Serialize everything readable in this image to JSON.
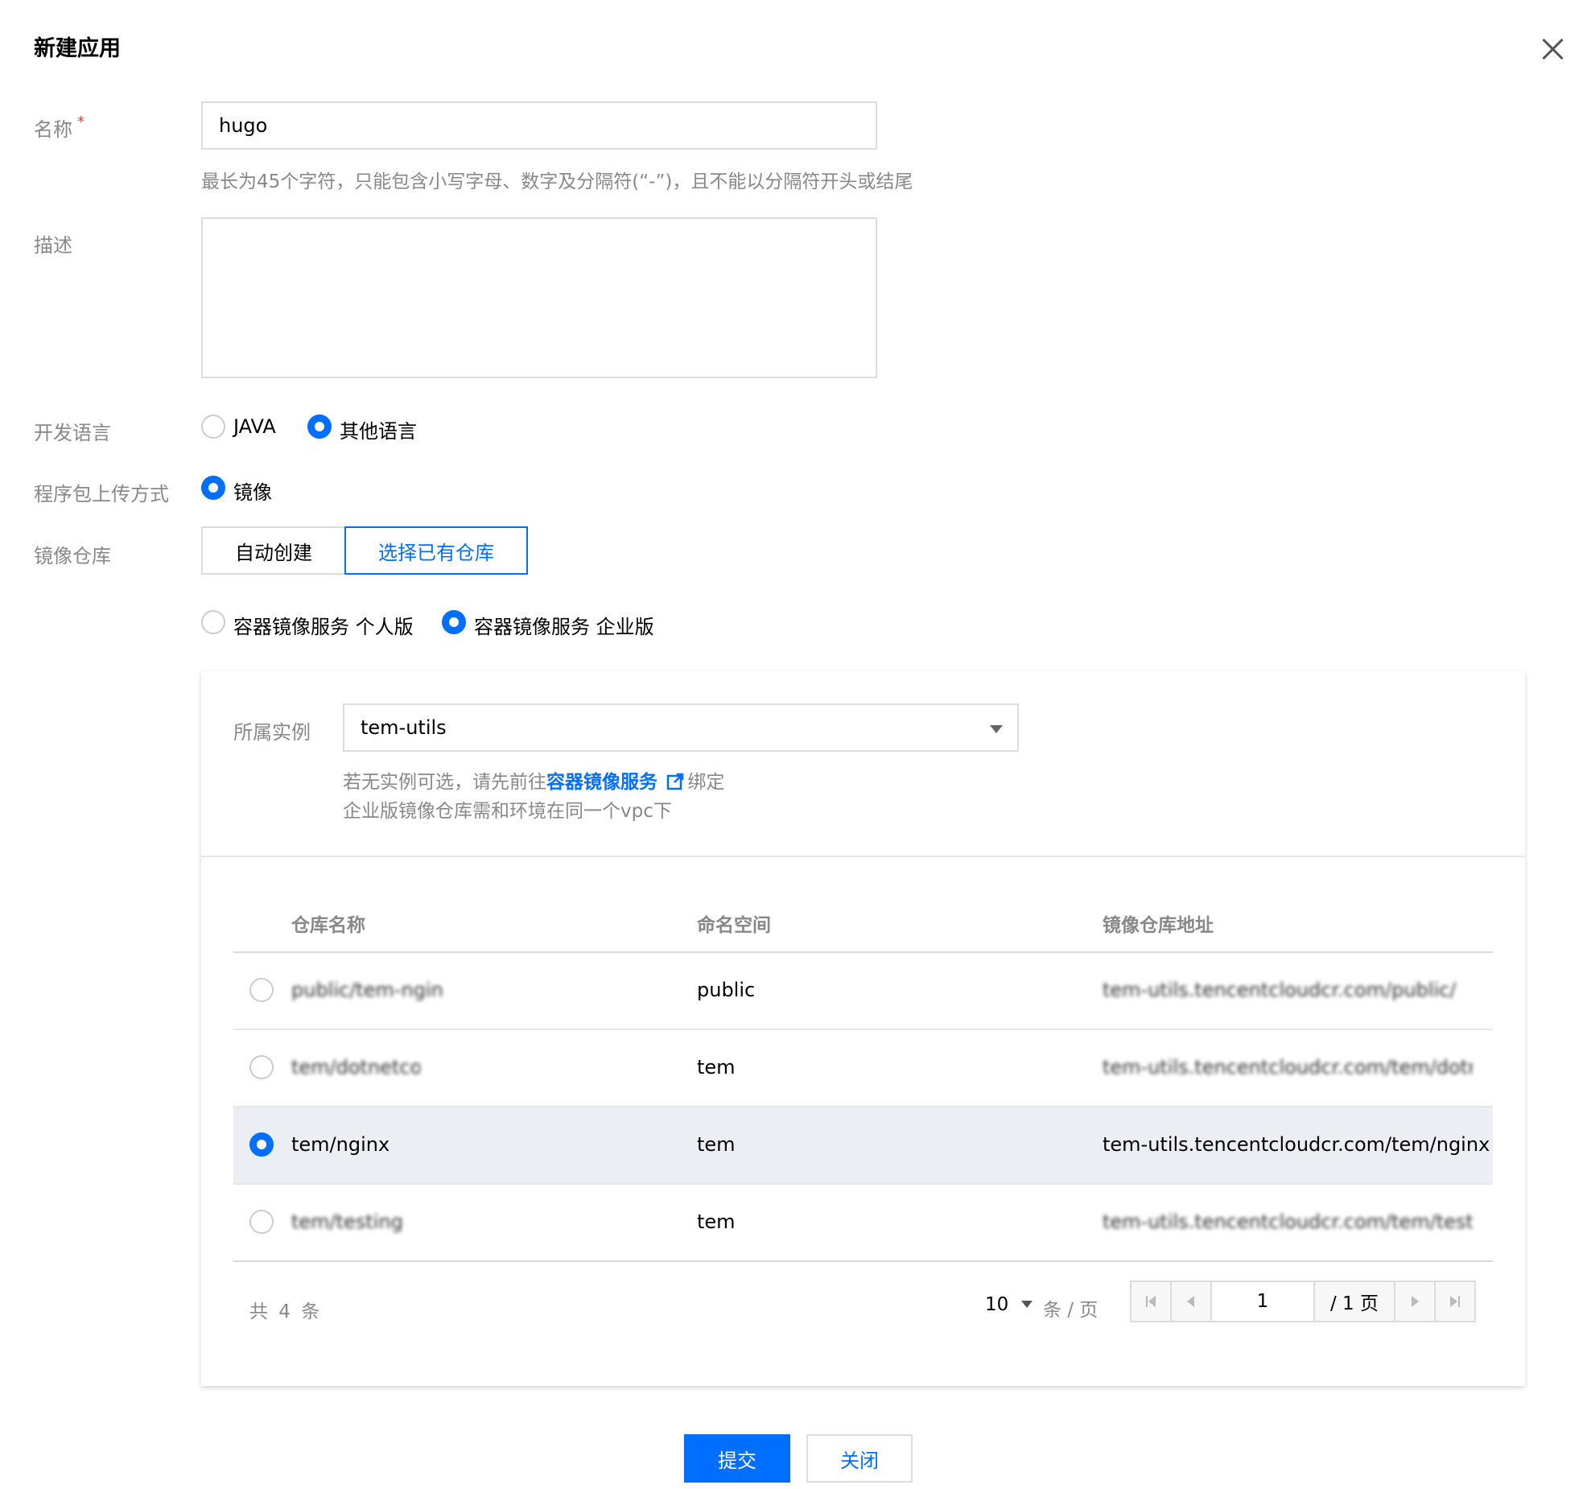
{
  "dialog": {
    "title": "新建应用"
  },
  "form": {
    "name_label": "名称",
    "name_required_mark": "*",
    "name_value": "hugo",
    "name_hint": "最长为45个字符，只能包含小写字母、数字及分隔符(“-”)，且不能以分隔符开头或结尾",
    "desc_label": "描述",
    "desc_value": "",
    "lang_label": "开发语言",
    "lang_options": [
      {
        "label": "JAVA",
        "checked": false
      },
      {
        "label": "其他语言",
        "checked": true
      }
    ],
    "upload_label": "程序包上传方式",
    "upload_option": {
      "label": "镜像",
      "checked": true
    },
    "repo_label": "镜像仓库",
    "repo_tabs": [
      {
        "label": "自动创建",
        "active": false
      },
      {
        "label": "选择已有仓库",
        "active": true
      }
    ],
    "registry_options": [
      {
        "label": "容器镜像服务 个人版",
        "checked": false
      },
      {
        "label": "容器镜像服务 企业版",
        "checked": true
      }
    ]
  },
  "panel": {
    "instance_label": "所属实例",
    "instance_value": "tem-utils",
    "hint_prefix": "若无实例可选，请先前往",
    "hint_link": "容器镜像服务",
    "hint_suffix": "绑定",
    "hint_line2": "企业版镜像仓库需和环境在同一个vpc下",
    "table": {
      "headers": [
        "仓库名称",
        "命名空间",
        "镜像仓库地址"
      ],
      "rows": [
        {
          "name": "public/tem-nginx",
          "namespace": "public",
          "address": "tem-utils.tencentcloudcr.com/public/tem",
          "selected": false,
          "obscured": true
        },
        {
          "name": "tem/dotnetcore",
          "namespace": "tem",
          "address": "tem-utils.tencentcloudcr.com/tem/dotnetcore",
          "selected": false,
          "obscured": true
        },
        {
          "name": "tem/nginx",
          "namespace": "tem",
          "address": "tem-utils.tencentcloudcr.com/tem/nginx",
          "selected": true,
          "obscured": false
        },
        {
          "name": "tem/testing",
          "namespace": "tem",
          "address": "tem-utils.tencentcloudcr.com/tem/testing",
          "selected": false,
          "obscured": true
        }
      ]
    },
    "pagination": {
      "total_text": "共 4 条",
      "page_size": "10",
      "per_page_text": "条 / 页",
      "current_page": "1",
      "total_pages_text": "/ 1 页"
    }
  },
  "footer": {
    "submit_label": "提交",
    "close_label": "关闭"
  },
  "colors": {
    "primary": "#006eff",
    "selected_row": "#ebeef2",
    "label_gray": "#888888"
  }
}
